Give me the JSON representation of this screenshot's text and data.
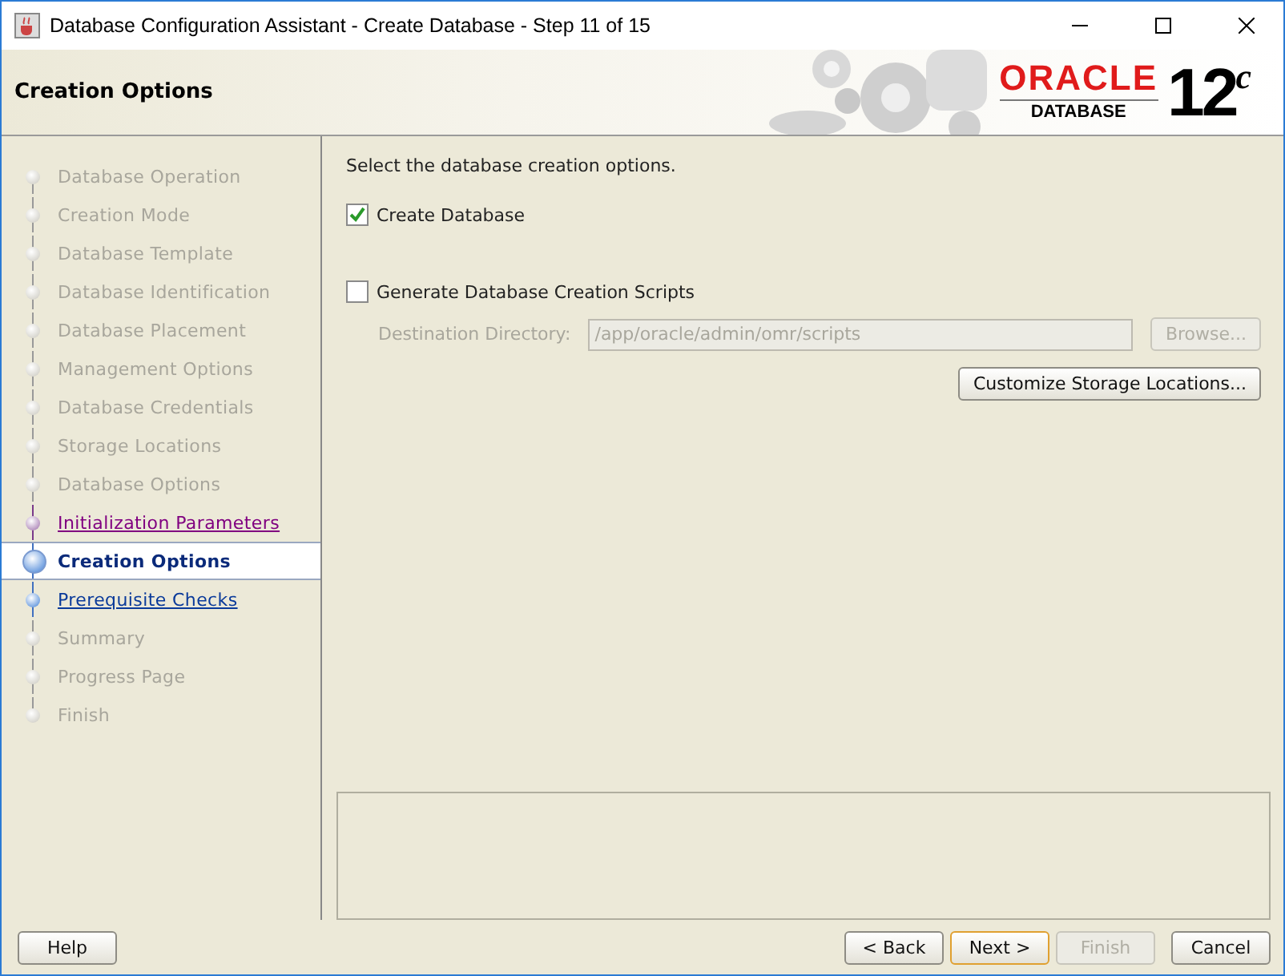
{
  "window": {
    "title": "Database Configuration Assistant - Create Database - Step 11 of 15"
  },
  "header": {
    "title": "Creation Options",
    "logo_brand": "ORACLE",
    "logo_product": "DATABASE",
    "logo_version": "12",
    "logo_suffix": "c"
  },
  "steps": [
    {
      "label": "Database Operation",
      "kind": "done",
      "selected": false
    },
    {
      "label": "Creation Mode",
      "kind": "done",
      "selected": false
    },
    {
      "label": "Database Template",
      "kind": "done",
      "selected": false
    },
    {
      "label": "Database Identification",
      "kind": "done",
      "selected": false
    },
    {
      "label": "Database Placement",
      "kind": "done",
      "selected": false
    },
    {
      "label": "Management Options",
      "kind": "done",
      "selected": false
    },
    {
      "label": "Database Credentials",
      "kind": "done",
      "selected": false
    },
    {
      "label": "Storage Locations",
      "kind": "done",
      "selected": false
    },
    {
      "label": "Database Options",
      "kind": "done",
      "selected": false
    },
    {
      "label": "Initialization Parameters",
      "kind": "visited",
      "selected": false
    },
    {
      "label": "Creation Options",
      "kind": "current",
      "selected": true
    },
    {
      "label": "Prerequisite Checks",
      "kind": "next",
      "selected": false
    },
    {
      "label": "Summary",
      "kind": "pending",
      "selected": false
    },
    {
      "label": "Progress Page",
      "kind": "pending",
      "selected": false
    },
    {
      "label": "Finish",
      "kind": "pending",
      "selected": false
    }
  ],
  "content": {
    "instruction": "Select the database creation options.",
    "create_database": {
      "label": "Create Database",
      "checked": true
    },
    "generate_scripts": {
      "label": "Generate Database Creation Scripts",
      "checked": false
    },
    "destination": {
      "label": "Destination Directory:",
      "value": "/app/oracle/admin/omr/scripts",
      "disabled": true
    },
    "browse_button": {
      "label": "Browse...",
      "disabled": true
    },
    "customize_button": {
      "label": "Customize Storage Locations..."
    }
  },
  "buttons": [
    {
      "label": "Help",
      "disabled": false,
      "default": false
    },
    {
      "label": "< Back",
      "disabled": false,
      "default": false
    },
    {
      "label": "Next >",
      "disabled": false,
      "default": true
    },
    {
      "label": "Finish",
      "disabled": true,
      "default": false
    },
    {
      "label": "Cancel",
      "disabled": false,
      "default": false
    }
  ]
}
